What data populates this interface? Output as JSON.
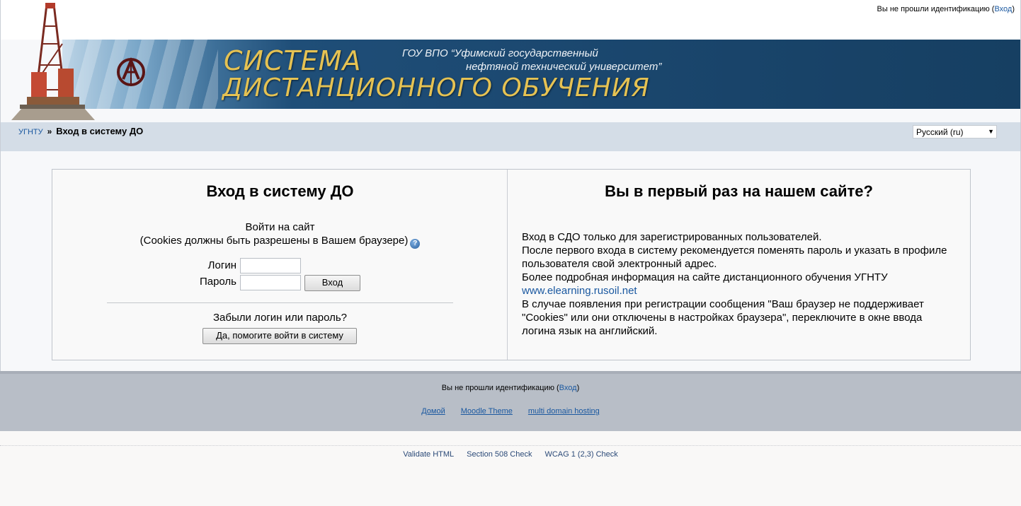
{
  "header": {
    "login_info_prefix": "Вы не прошли идентификацию (",
    "login_link": "Вход",
    "login_info_suffix": ")"
  },
  "banner": {
    "title_line1": "СИСТЕМА",
    "title_line2": "ДИСТАНЦИОННОГО ОБУЧЕНИЯ",
    "subtitle_line1": "ГОУ ВПО “Уфимский государственный",
    "subtitle_line2": "нефтяной технический университет”"
  },
  "breadcrumb": {
    "home": "УГНТУ",
    "separator": "»",
    "current": "Вход в систему ДО"
  },
  "language": {
    "selected": "Русский (ru)"
  },
  "login": {
    "title": "Вход в систему ДО",
    "enter_line1": "Войти на сайт",
    "enter_line2": "(Cookies должны быть разрешены в Вашем браузере)",
    "username_label": "Логин",
    "password_label": "Пароль",
    "username_value": "",
    "password_value": "",
    "submit_label": "Вход",
    "forgot_text": "Забыли логин или пароль?",
    "help_button": "Да, помогите войти в систему"
  },
  "firsttime": {
    "title": "Вы в первый раз на нашем сайте?",
    "line1": "Вход в СДО только для зарегистрированных пользователей.",
    "line2": "После первого входа в систему рекомендуется поменять пароль и указать в профиле пользователя свой электронный адрес.",
    "line3": "Более подробная информация на сайте дистанционного обучения УГНТУ",
    "link": "www.elearning.rusoil.net",
    "line4": "В случае появления при регистрации сообщения \"Ваш браузер не поддерживает \"Cookies\" или они отключены в настройках браузера\", переключите в окне ввода логина язык на английский."
  },
  "footer": {
    "login_info_prefix": "Вы не прошли идентификацию (",
    "login_link": "Вход",
    "login_info_suffix": ")",
    "links": [
      "Домой",
      "Moodle Theme",
      "multi domain hosting"
    ],
    "validators": [
      "Validate HTML",
      "Section 508 Check",
      "WCAG 1 (2,3) Check"
    ]
  },
  "colors": {
    "banner_dark": "#1a466d",
    "banner_gold": "#e5c253",
    "navbar": "#d4dde7",
    "footer": "#b8bec7",
    "link": "#1a58a0"
  }
}
